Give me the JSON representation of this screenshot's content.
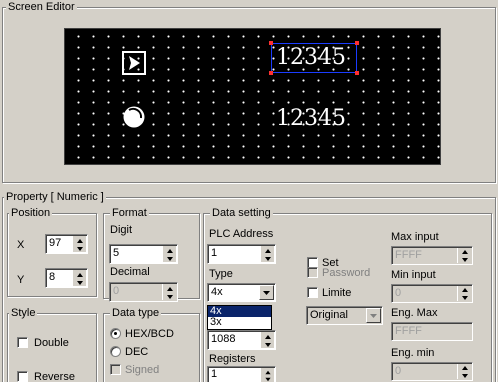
{
  "screen_editor": {
    "title": "Screen Editor",
    "display_values": [
      "12345",
      "12345"
    ]
  },
  "property": {
    "title": "Property [ Numeric ]",
    "position": {
      "title": "Position",
      "x_label": "X",
      "x_value": "97",
      "y_label": "Y",
      "y_value": "8"
    },
    "format": {
      "title": "Format",
      "digit_label": "Digit",
      "digit_value": "5",
      "decimal_label": "Decimal",
      "decimal_value": "0"
    },
    "data_type": {
      "title": "Data type",
      "options": [
        "HEX/BCD",
        "DEC",
        "Signed"
      ],
      "selected": "HEX/BCD"
    },
    "style": {
      "title": "Style",
      "double_label": "Double",
      "reverse_label": "Reverse"
    },
    "data_setting": {
      "title": "Data setting",
      "plc_address_label": "PLC Address",
      "plc_address_value": "1",
      "type_label": "Type",
      "type_value": "4x",
      "type_options": [
        "4x",
        "3x"
      ],
      "type_highlighted": "4x",
      "address_value": "1088",
      "registers_label": "Registers",
      "registers_value": "1",
      "set_label": "Set",
      "password_label": "Password",
      "limite_label": "Limite",
      "mode_value": "Original",
      "max_input_label": "Max input",
      "max_input_value": "FFFF",
      "min_input_label": "Min input",
      "min_input_value": "0",
      "eng_max_label": "Eng. Max",
      "eng_max_value": "FFFF",
      "eng_min_label": "Eng. min",
      "eng_min_value": "0"
    }
  }
}
